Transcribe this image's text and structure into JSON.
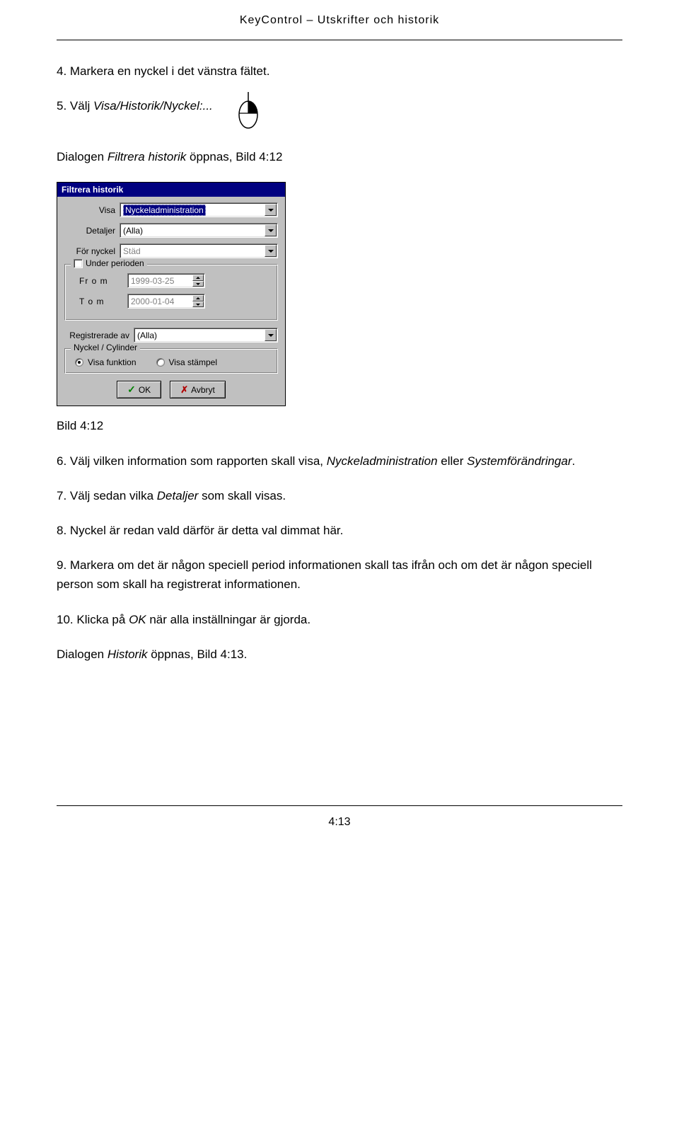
{
  "header": "KeyControl – Utskrifter och historik",
  "footer": "4:13",
  "steps": {
    "s4": "4. Markera en nyckel i det vänstra fältet.",
    "s5_prefix": "5. Välj ",
    "s5_italic": "Visa/Historik/Nyckel:...",
    "s5b_prefix": "Dialogen ",
    "s5b_italic": "Filtrera historik",
    "s5b_suffix": " öppnas, Bild 4:12",
    "caption": "Bild 4:12",
    "s6_prefix": "6. Välj vilken information som rapporten skall visa, ",
    "s6_italic1": "Nyckeladministration",
    "s6_mid": " eller ",
    "s6_italic2": "Systemförändringar",
    "s6_suffix": ".",
    "s7_prefix": "7. Välj sedan vilka ",
    "s7_italic": "Detaljer",
    "s7_suffix": " som skall visas.",
    "s8": "8. Nyckel är redan vald därför är detta val dimmat här.",
    "s9": "9. Markera om det är någon speciell period informationen skall tas ifrån och om det är någon speciell person som skall ha registrerat informationen.",
    "s10_prefix": "10. Klicka på ",
    "s10_italic": "OK",
    "s10_suffix": " när alla inställningar är gjorda.",
    "s11_prefix": "Dialogen ",
    "s11_italic": "Historik",
    "s11_suffix": " öppnas, Bild 4:13."
  },
  "dialog": {
    "title": "Filtrera historik",
    "labels": {
      "visa": "Visa",
      "detaljer": "Detaljer",
      "for_nyckel": "För nyckel",
      "under_perioden": "Under perioden",
      "from": "Fr o m",
      "tom": "T o m",
      "registrerade_av": "Registrerade av",
      "nyckel_cylinder": "Nyckel / Cylinder",
      "visa_funktion": "Visa funktion",
      "visa_stampel": "Visa stämpel"
    },
    "values": {
      "visa": "Nyckeladministration",
      "detaljer": "(Alla)",
      "for_nyckel": "Städ",
      "from": "1999-03-25",
      "tom": "2000-01-04",
      "registrerade_av": "(Alla)"
    },
    "buttons": {
      "ok": "OK",
      "avbryt": "Avbryt"
    }
  }
}
